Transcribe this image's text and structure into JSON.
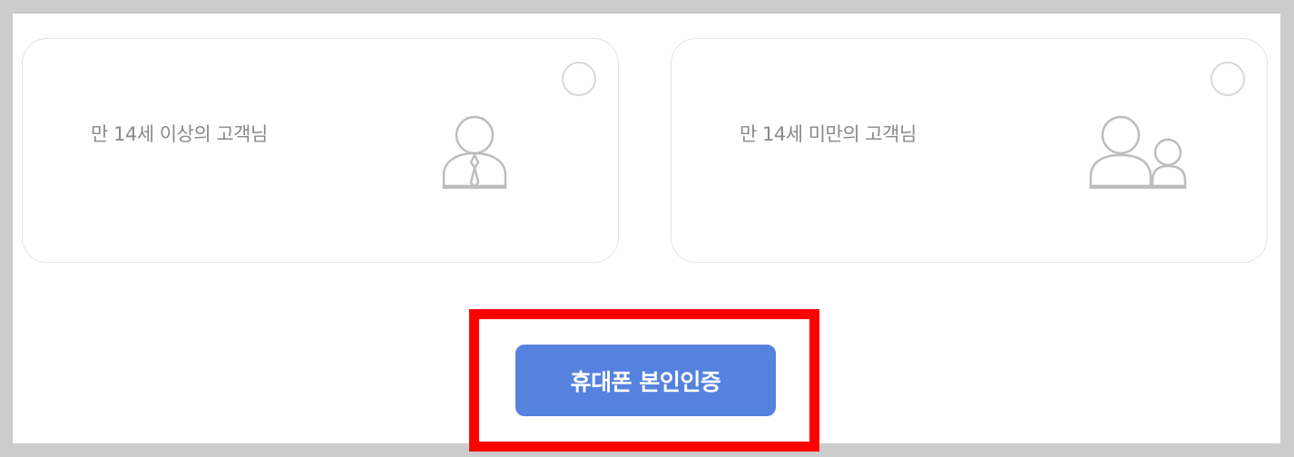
{
  "options": [
    {
      "id": "adult",
      "label": "만 14세 이상의 고객님",
      "icon": "adult-person-icon",
      "selected": false
    },
    {
      "id": "minor",
      "label": "만 14세 미만의 고객님",
      "icon": "parent-child-icon",
      "selected": false
    }
  ],
  "action": {
    "label": "휴대폰 본인인증",
    "color": "#5582df",
    "highlight_color": "#ff0000"
  },
  "colors": {
    "background": "#cccccc",
    "panel": "#ffffff",
    "card_border": "#e3e3e3",
    "label_text": "#8a8a8a",
    "icon_stroke": "#bdbdbd"
  }
}
